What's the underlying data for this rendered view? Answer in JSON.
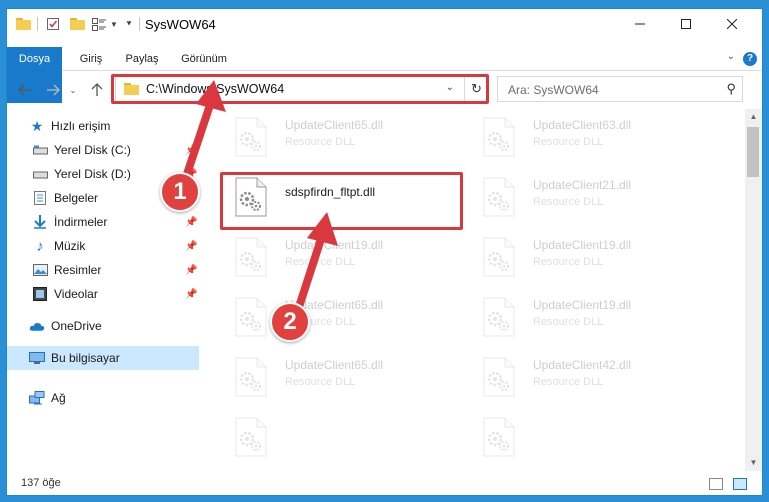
{
  "window": {
    "title": "SysWOW64"
  },
  "ribbon": {
    "tabs": [
      {
        "label": "Dosya"
      },
      {
        "label": "Giriş"
      },
      {
        "label": "Paylaş"
      },
      {
        "label": "Görünüm"
      }
    ]
  },
  "address": {
    "path": "C:\\Windows\\SysWOW64"
  },
  "search": {
    "placeholder": "Ara: SysWOW64"
  },
  "nav": {
    "items": [
      {
        "label": "Hızlı erişim"
      },
      {
        "label": "Yerel Disk (C:)"
      },
      {
        "label": "Yerel Disk (D:)"
      },
      {
        "label": "Belgeler"
      },
      {
        "label": "İndirmeler"
      },
      {
        "label": "Müzik"
      },
      {
        "label": "Resimler"
      },
      {
        "label": "Videolar"
      },
      {
        "label": "OneDrive"
      },
      {
        "label": "Bu bilgisayar"
      },
      {
        "label": "Ağ"
      }
    ]
  },
  "files": [
    {
      "name": "UpdateClient65.dll",
      "type": "Resource DLL"
    },
    {
      "name": "UpdateClient63.dll",
      "type": "Resource DLL"
    },
    {
      "name": "sdspfirdn_fltpt.dll",
      "type": ""
    },
    {
      "name": "UpdateClient21.dll",
      "type": "Resource DLL"
    },
    {
      "name": "UpdateClient19.dll",
      "type": "Resource DLL"
    },
    {
      "name": "UpdateClient19.dll",
      "type": "Resource DLL"
    },
    {
      "name": "UpdateClient65.dll",
      "type": "Resource DLL"
    },
    {
      "name": "UpdateClient19.dll",
      "type": "Resource DLL"
    },
    {
      "name": "UpdateClient65.dll",
      "type": "Resource DLL"
    },
    {
      "name": "UpdateClient42.dll",
      "type": "Resource DLL"
    },
    {
      "name": "",
      "type": ""
    },
    {
      "name": "",
      "type": ""
    }
  ],
  "status": {
    "count": "137 öğe"
  },
  "annotations": {
    "step1": "1",
    "step2": "2"
  },
  "colors": {
    "accent": "#1979ca",
    "highlight": "#d9393e",
    "selection": "#cce8ff"
  }
}
